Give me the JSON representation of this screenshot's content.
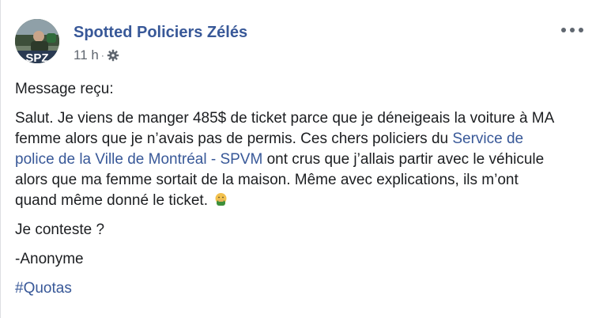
{
  "post": {
    "author": "Spotted Policiers Zélés",
    "avatar_text": "SPZ",
    "time": "11 h",
    "separator": "·",
    "privacy_icon": "gear-icon",
    "more_icon": "more-options-icon",
    "intro": "Message reçu:",
    "body_part1": "Salut. Je viens de manger 485$ de ticket parce que je déneigeais la voiture à MA femme alors que je n’avais pas de permis. Ces chers policiers du ",
    "body_link": "Service de police de la Ville de Montréal - SPVM",
    "body_part2": " ont crus que j’allais partir avec le véhicule alors que ma femme sortait de la maison. Même avec explications, ils m’ont quand même donné le ticket.",
    "emoji": "face-with-hand-over-mouth-emoji",
    "question": "Je conteste ?",
    "signature": "-Anonyme",
    "hashtag": "#Quotas"
  },
  "colors": {
    "link": "#385898",
    "meta": "#606770",
    "text": "#1c1e21"
  }
}
